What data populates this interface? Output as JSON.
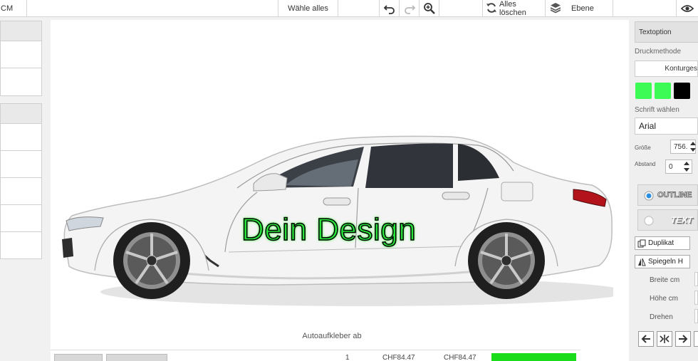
{
  "toolbar": {
    "left_fragment": "CM",
    "select_all": "Wähle alles",
    "clear_all": "Alles löschen",
    "layer": "Ebene"
  },
  "canvas": {
    "design_text": "Dein Design",
    "caption": "Autoaufkleber ab"
  },
  "bottom": {
    "qty": "1",
    "price1": "CHF84.47",
    "price2": "CHF84.47"
  },
  "right_panel": {
    "tab": "Textoption",
    "print_method_label": "Druckmethode",
    "print_method_value": "Konturges",
    "colors": [
      "#3dfb55",
      "#3dfb55",
      "#000000"
    ],
    "font_label": "Schrift wählen",
    "font_value": "Arial",
    "size_label": "Größe",
    "size_value": "756.",
    "spacing_label": "Abstand",
    "spacing_value": "0",
    "outline_label": "OUTLINE",
    "text_label": "TEXT",
    "duplicate": "Duplikat",
    "mirror": "Spiegeln H",
    "width_label": "Breite cm",
    "height_label": "Höhe cm",
    "rotate_label": "Drehen"
  },
  "car": {
    "body_color": "#f4f4f4"
  }
}
